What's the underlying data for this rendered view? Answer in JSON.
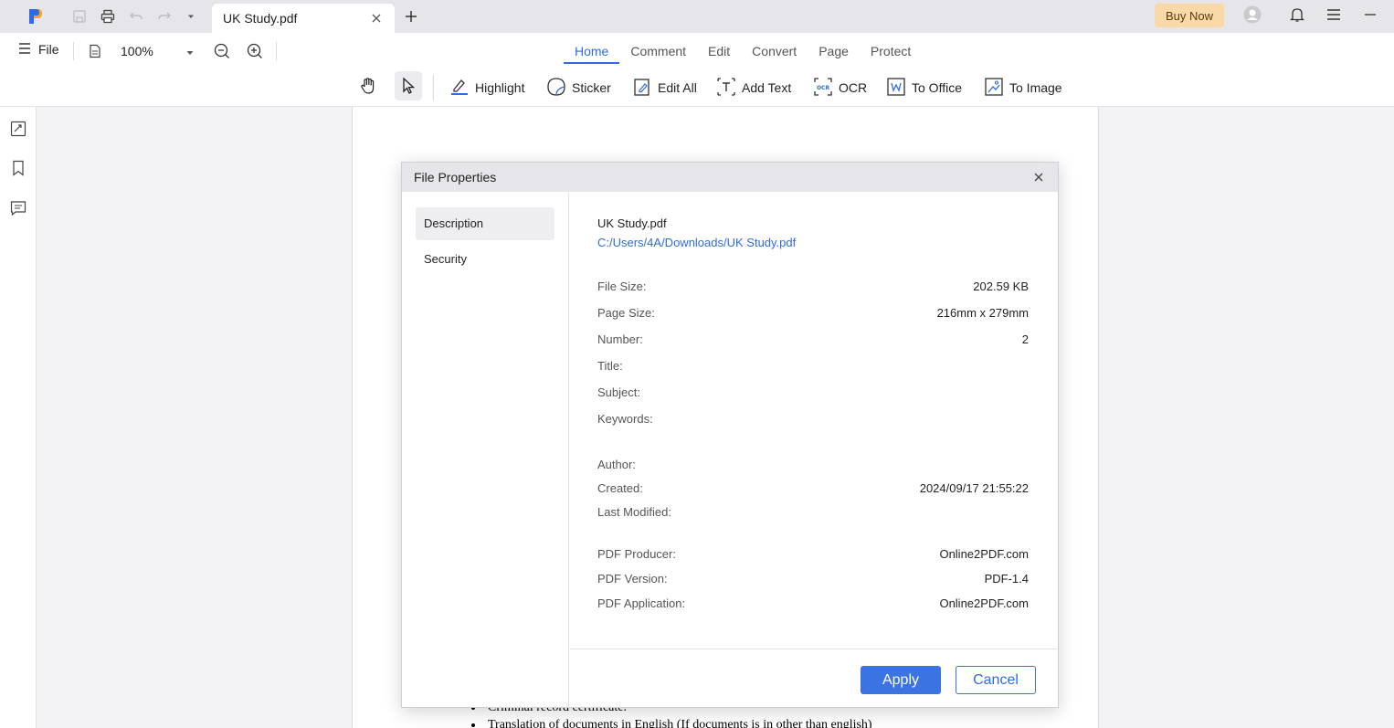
{
  "titlebar": {
    "tab_title": "UK Study.pdf",
    "buy_now_label": "Buy Now",
    "icons": [
      "app-logo-icon",
      "save-icon",
      "print-icon",
      "undo-icon",
      "redo-icon",
      "dropdown-icon",
      "tab-close-icon",
      "new-tab-icon",
      "account-icon",
      "notification-bell-icon",
      "hamburger-menu-icon",
      "minimize-icon"
    ]
  },
  "menubar": {
    "file_label": "File",
    "zoom_value": "100%",
    "tabs": [
      {
        "label": "Home",
        "active": true
      },
      {
        "label": "Comment",
        "active": false
      },
      {
        "label": "Edit",
        "active": false
      },
      {
        "label": "Convert",
        "active": false
      },
      {
        "label": "Page",
        "active": false
      },
      {
        "label": "Protect",
        "active": false
      }
    ]
  },
  "toolbar": {
    "tools": [
      {
        "label": "Highlight",
        "icon": "highlight-icon"
      },
      {
        "label": "Sticker",
        "icon": "sticker-icon"
      },
      {
        "label": "Edit All",
        "icon": "edit-all-icon"
      },
      {
        "label": "Add Text",
        "icon": "add-text-icon"
      },
      {
        "label": "OCR",
        "icon": "ocr-icon"
      },
      {
        "label": "To Office",
        "icon": "to-office-icon"
      },
      {
        "label": "To Image",
        "icon": "to-image-icon"
      }
    ]
  },
  "document": {
    "visible_lines": [
      "Criminal record certificate.",
      "Translation of documents in English (If documents is in other than english)"
    ]
  },
  "dialog": {
    "title": "File Properties",
    "sidebar": [
      {
        "label": "Description",
        "active": true
      },
      {
        "label": "Security",
        "active": false
      }
    ],
    "file_name": "UK Study.pdf",
    "file_path": "C:/Users/4A/Downloads/UK Study.pdf",
    "properties": [
      {
        "label": "File Size:",
        "value": "202.59 KB"
      },
      {
        "label": "Page Size:",
        "value": "216mm x 279mm"
      },
      {
        "label": "Number:",
        "value": "2"
      },
      {
        "label": "Title:",
        "value": ""
      },
      {
        "label": "Subject:",
        "value": ""
      },
      {
        "label": "Keywords:",
        "value": ""
      },
      {
        "label": "Author:",
        "value": ""
      },
      {
        "label": "Created:",
        "value": "2024/09/17 21:55:22"
      },
      {
        "label": "Last Modified:",
        "value": ""
      },
      {
        "label": "PDF Producer:",
        "value": "Online2PDF.com"
      },
      {
        "label": "PDF Version:",
        "value": "PDF-1.4"
      },
      {
        "label": "PDF Application:",
        "value": "Online2PDF.com"
      }
    ],
    "apply_label": "Apply",
    "cancel_label": "Cancel"
  },
  "colors": {
    "accent": "#2f6be0",
    "button_primary": "#3b73e3",
    "buy_now_bg": "#f8d9a7",
    "titlebar_bg": "#e6e6ea"
  }
}
